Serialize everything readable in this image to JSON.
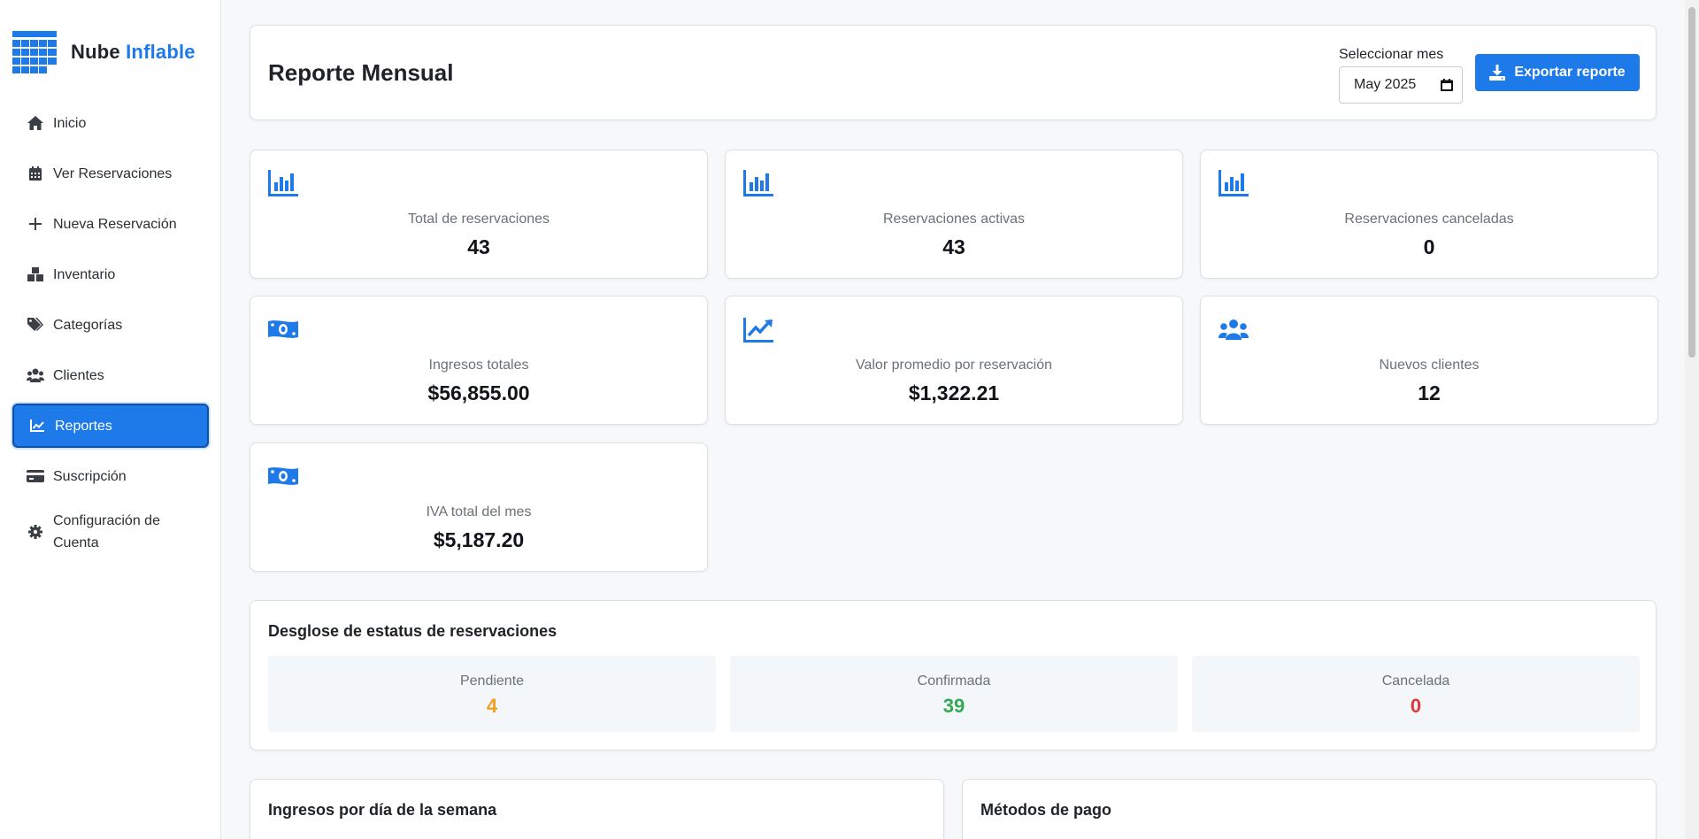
{
  "brand": {
    "name_part1": "Nube",
    "name_part2": "Inflable",
    "accent_color": "#1d7ae8"
  },
  "sidebar": {
    "items": [
      {
        "label": "Inicio",
        "icon": "home-icon",
        "active": false
      },
      {
        "label": "Ver Reservaciones",
        "icon": "calendar-icon",
        "active": false
      },
      {
        "label": "Nueva Reservación",
        "icon": "plus-icon",
        "active": false
      },
      {
        "label": "Inventario",
        "icon": "boxes-icon",
        "active": false
      },
      {
        "label": "Categorías",
        "icon": "tags-icon",
        "active": false
      },
      {
        "label": "Clientes",
        "icon": "users-icon",
        "active": false
      },
      {
        "label": "Reportes",
        "icon": "chart-line-icon",
        "active": true
      },
      {
        "label": "Suscripción",
        "icon": "credit-card-icon",
        "active": false
      },
      {
        "label": "Configuración de Cuenta",
        "icon": "gear-icon",
        "active": false
      }
    ]
  },
  "header": {
    "title": "Reporte Mensual",
    "month_label": "Seleccionar mes",
    "month_value": "May 2025",
    "export_label": "Exportar reporte"
  },
  "stats": [
    {
      "label": "Total de reservaciones",
      "value": "43",
      "icon": "bar-chart-icon"
    },
    {
      "label": "Reservaciones activas",
      "value": "43",
      "icon": "bar-chart-icon"
    },
    {
      "label": "Reservaciones canceladas",
      "value": "0",
      "icon": "bar-chart-icon"
    },
    {
      "label": "Ingresos totales",
      "value": "$56,855.00",
      "icon": "money-bill-icon"
    },
    {
      "label": "Valor promedio por reservación",
      "value": "$1,322.21",
      "icon": "chart-trend-icon"
    },
    {
      "label": "Nuevos clientes",
      "value": "12",
      "icon": "users-icon"
    },
    {
      "label": "IVA total del mes",
      "value": "$5,187.20",
      "icon": "money-bill-icon"
    }
  ],
  "breakdown": {
    "title": "Desglose de estatus de reservaciones",
    "items": [
      {
        "label": "Pendiente",
        "value": "4",
        "color": "#f0a020"
      },
      {
        "label": "Confirmada",
        "value": "39",
        "color": "#34a853"
      },
      {
        "label": "Cancelada",
        "value": "0",
        "color": "#e5333d"
      }
    ]
  },
  "bottom": {
    "left_title": "Ingresos por día de la semana",
    "right_title": "Métodos de pago"
  }
}
